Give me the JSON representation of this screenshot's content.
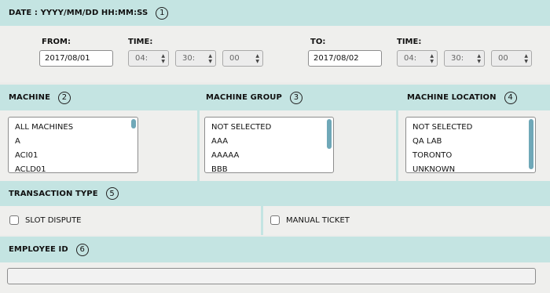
{
  "date_section": {
    "header": "DATE : YYYY/MM/DD HH:MM:SS",
    "number": "1",
    "from_label": "FROM:",
    "from_date": "2017/08/01",
    "time_label": "TIME:",
    "from_hour": "04:",
    "from_minute": "30:",
    "from_second": "00",
    "to_label": "TO:",
    "to_date": "2017/08/02",
    "to_hour": "04:",
    "to_minute": "30:",
    "to_second": "00"
  },
  "machine": {
    "header": "MACHINE",
    "number": "2",
    "items": [
      "ALL MACHINES",
      "A",
      "ACI01",
      "ACLD01"
    ]
  },
  "machine_group": {
    "header": "MACHINE GROUP",
    "number": "3",
    "items": [
      "NOT SELECTED",
      "AAA",
      "AAAAA",
      "BBB"
    ]
  },
  "machine_location": {
    "header": "MACHINE LOCATION",
    "number": "4",
    "items": [
      "NOT SELECTED",
      "QA LAB",
      "TORONTO",
      "UNKNOWN"
    ]
  },
  "transaction_type": {
    "header": "TRANSACTION TYPE",
    "number": "5",
    "options": [
      {
        "label": "SLOT DISPUTE",
        "checked": false
      },
      {
        "label": "MANUAL TICKET",
        "checked": false
      }
    ]
  },
  "employee": {
    "header": "EMPLOYEE ID",
    "number": "6",
    "value": ""
  },
  "colors": {
    "header_bg": "#c4e4e2",
    "panel_bg": "#efefed",
    "scrollbar": "#6fa8b8"
  }
}
